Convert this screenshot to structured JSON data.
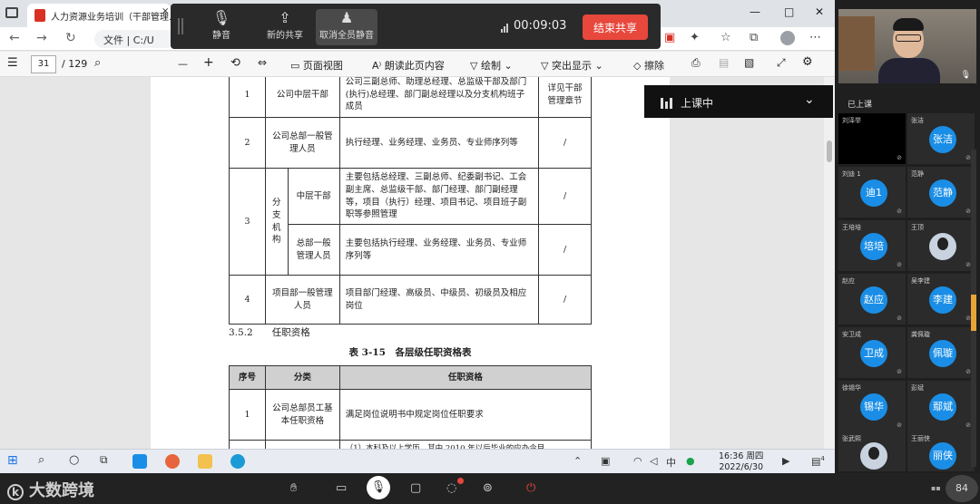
{
  "browser": {
    "tab_title": "人力资源业务培训（干部管理...",
    "tab_close": "×",
    "url_info": "ⓘ",
    "url_text": "文件 | C:/U",
    "win_min": "—",
    "win_max": "□",
    "win_close": "✕"
  },
  "pdf_toolbar": {
    "page_current": "31",
    "page_total": "/ 129",
    "zoom_out": "—",
    "zoom_in": "+",
    "page_view": "页面视图",
    "read_aloud": "朗读此页内容",
    "draw": "绘制",
    "highlight": "突出显示",
    "erase": "擦除"
  },
  "meeting_bar": {
    "mute_label": "静音",
    "new_share_label": "新的共享",
    "mute_all_label": "取消全员静音",
    "timer": "00:09:03",
    "end_share": "结束共享"
  },
  "class_status": {
    "label": "上课中"
  },
  "document": {
    "table1": {
      "rows": [
        {
          "no": "1",
          "category": "公司中层干部",
          "desc": "公司三副总师、助理总经理、总监级干部及部门(执行)总经理、部门副总经理以及分支机构班子成员",
          "req": "详见干部管理章节"
        },
        {
          "no": "2",
          "category": "公司总部一般管理人员",
          "desc": "执行经理、业务经理、业务员、专业师序列等",
          "req": "/"
        },
        {
          "no": "3",
          "category": "分支机构",
          "sub1": "中层干部",
          "desc1": "主要包括总经理、三副总师、纪委副书记、工会副主席、总监级干部、部门经理、部门副经理等，项目（执行）经理、项目书记、项目班子副职等参照管理",
          "req1": "/",
          "sub2": "总部一般管理人员",
          "desc2": "主要包括执行经理、业务经理、业务员、专业师序列等",
          "req2": "/"
        },
        {
          "no": "4",
          "category": "项目部一般管理人员",
          "desc": "项目部门经理、高级员、中级员、初级员及相应岗位",
          "req": "/"
        }
      ]
    },
    "section": "3.5.2　　任职资格",
    "caption": "表 3-15　各层级任职资格表",
    "table2": {
      "headers": [
        "序号",
        "分类",
        "任职资格"
      ],
      "rows": [
        {
          "no": "1",
          "category": "公司总部员工基本任职资格",
          "req": "满足岗位说明书中规定岗位任职要求"
        },
        {
          "no": "",
          "category": "",
          "req": "（1）本科及以上学历，其中 2010 年以后毕业的应办令目"
        }
      ]
    }
  },
  "taskbar": {
    "time": "16:36 周四",
    "date": "2022/6/30",
    "notif_count": "4"
  },
  "participants": {
    "header": "已上课",
    "tiles": [
      {
        "name": "刘泽举",
        "avatar": ""
      },
      {
        "name": "张洁",
        "avatar": "张洁"
      },
      {
        "name": "刘迪 1",
        "avatar": "迪1"
      },
      {
        "name": "范静",
        "avatar": "范静"
      },
      {
        "name": "王培培",
        "avatar": "培培"
      },
      {
        "name": "王顶",
        "avatar": ""
      },
      {
        "name": "赵应",
        "avatar": "赵应"
      },
      {
        "name": "吴李建",
        "avatar": "李建"
      },
      {
        "name": "安卫成",
        "avatar": "卫成"
      },
      {
        "name": "龚佩璇",
        "avatar": "佩璇"
      },
      {
        "name": "徐锡华",
        "avatar": "锡华"
      },
      {
        "name": "彭斌",
        "avatar": "鄢斌"
      },
      {
        "name": "张武熙",
        "avatar": ""
      },
      {
        "name": "王丽侠",
        "avatar": "丽侠"
      }
    ]
  },
  "bottom": {
    "brand": "大数跨境",
    "zoom": "84"
  },
  "colors": {
    "accent_red": "#e8473c",
    "avatar_blue": "#1a8ee6",
    "scroll_orange": "#e8a436"
  }
}
